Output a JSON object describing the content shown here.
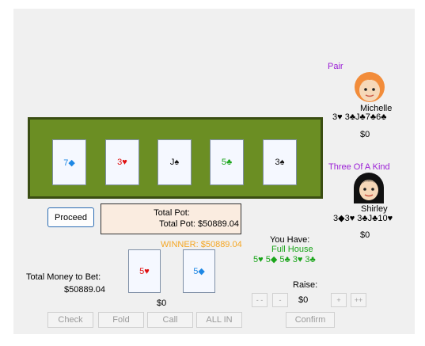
{
  "players": [
    {
      "hand": "Pair",
      "name": "Michelle",
      "cards": "3♥ 3♣J♣7♣6♣",
      "money": "$0"
    },
    {
      "hand": "Three Of A Kind",
      "name": "Shirley",
      "cards": "3◆3♥ 3♣J♣10♥",
      "money": "$0"
    }
  ],
  "community": [
    "7◆",
    "3♥",
    "J♠",
    "5♣",
    "3♠"
  ],
  "proceed_label": "Proceed",
  "pot": {
    "title": "Total Pot:",
    "value": "Total Pot: $50889.04"
  },
  "winner": "WINNER: $50889.04",
  "you": {
    "label": "You Have:",
    "hand": "Full House",
    "cards": "5♥ 5◆ 5♣ 3♥ 3♣"
  },
  "hole": [
    "5♥",
    "5◆"
  ],
  "bet": {
    "label": "Total Money to Bet:",
    "value": "$50889.04",
    "current": "$0"
  },
  "raise": {
    "label": "Raise:",
    "value": "$0",
    "minus2": "- -",
    "minus": "-",
    "plus": "+",
    "plus2": "++"
  },
  "actions": {
    "check": "Check",
    "fold": "Fold",
    "call": "Call",
    "allin": "ALL IN",
    "confirm": "Confirm"
  }
}
